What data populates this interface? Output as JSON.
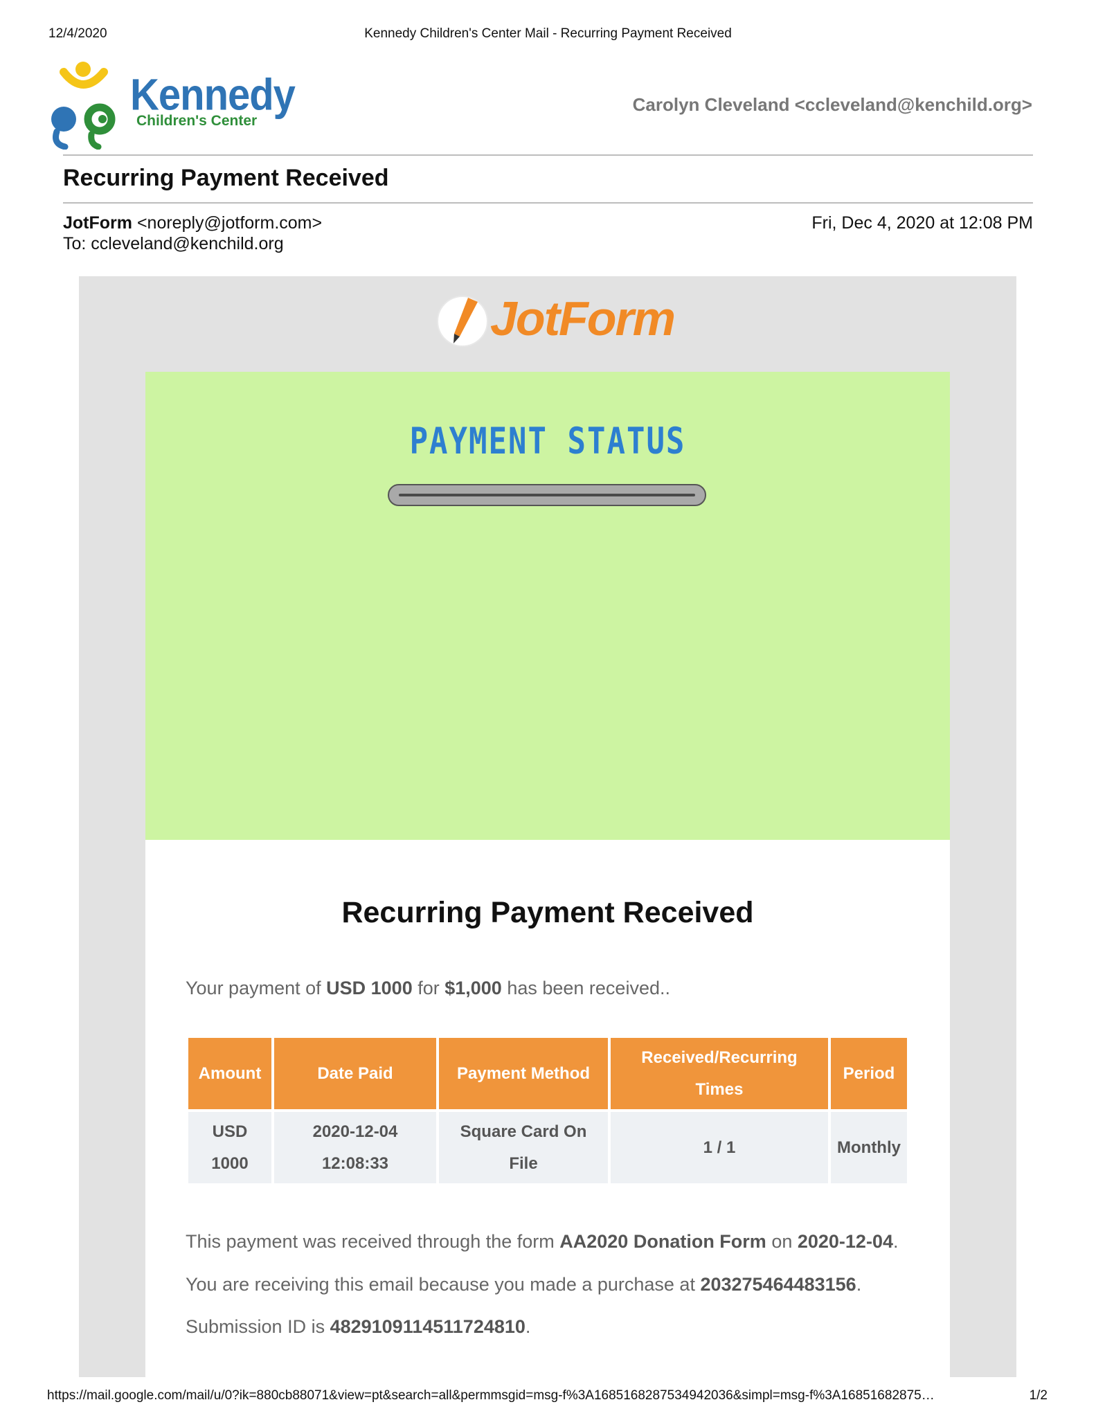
{
  "print_header": {
    "date": "12/4/2020",
    "title": "Kennedy Children's Center Mail - Recurring Payment Received"
  },
  "brand": {
    "logo_word": "Kennedy",
    "logo_sub": "Children's Center",
    "account": "Carolyn Cleveland <ccleveland@kenchild.org>"
  },
  "email": {
    "subject": "Recurring Payment Received",
    "sender_name": "JotForm",
    "sender_email": "<noreply@jotform.com>",
    "to": "To: ccleveland@kenchild.org",
    "date": "Fri, Dec 4, 2020 at 12:08 PM"
  },
  "body": {
    "brand_word": "JotForm",
    "status_title": "PAYMENT STATUS",
    "heading": "Recurring Payment Received",
    "amount_line": {
      "prefix": "Your payment of ",
      "amount": "USD 1000",
      "mid": " for ",
      "product": "$1,000",
      "suffix": " has been received.."
    },
    "table": {
      "headers": {
        "amount": "Amount",
        "date_paid": "Date Paid",
        "method": "Payment Method",
        "times": "Received/Recurring Times",
        "period": "Period"
      },
      "row": {
        "amount": "USD 1000",
        "date_paid": "2020-12-04 12:08:33",
        "method": "Square Card On File",
        "times": "1 / 1",
        "period": "Monthly"
      }
    },
    "form_line": {
      "prefix": "This payment was received through the form ",
      "form": "AA2020 Donation Form",
      "mid": " on ",
      "date": "2020-12-04",
      "suffix": "."
    },
    "purchase_line": {
      "prefix": "You are receiving this email because you made a purchase at ",
      "id": "203275464483156",
      "suffix": "."
    },
    "submission_line": {
      "prefix": "Submission ID is ",
      "id": "4829109114511724810",
      "suffix": "."
    }
  },
  "print_footer": {
    "url": "https://mail.google.com/mail/u/0?ik=880cb88071&view=pt&search=all&permmsgid=msg-f%3A1685168287534942036&simpl=msg-f%3A16851682875…",
    "page": "1/2"
  },
  "colors": {
    "brand_blue": "#2f74b5",
    "brand_green": "#2f8f3a",
    "jotform_orange": "#f18a26",
    "banner_green": "#cdf4a2",
    "table_header": "#f0953b"
  }
}
